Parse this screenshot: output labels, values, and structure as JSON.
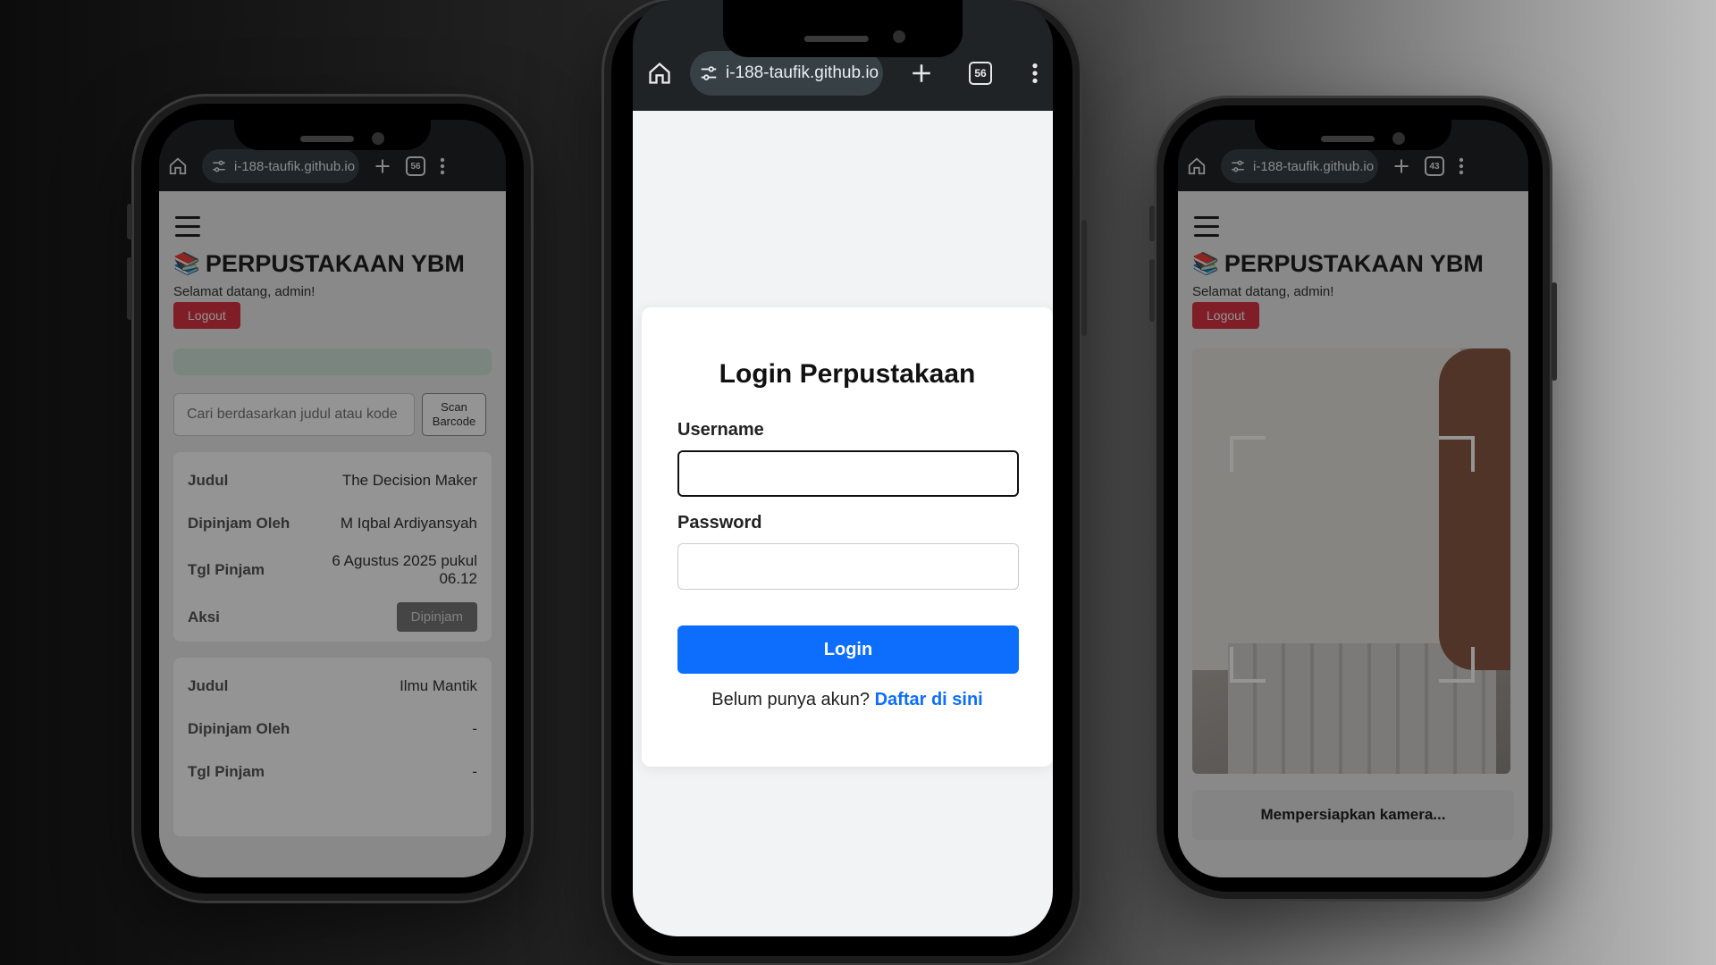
{
  "browser": {
    "url_left": "i-188-taufik.github.io",
    "url_center": "i-188-taufik.github.io",
    "url_right": "i-188-taufik.github.io",
    "tabs_left": "56",
    "tabs_center": "56",
    "tabs_right": "43",
    "icons": [
      "home-icon",
      "site-settings-icon",
      "new-tab-icon",
      "tab-switcher-icon",
      "menu-kebab-icon"
    ]
  },
  "app": {
    "title": "PERPUSTAKAAN YBM",
    "welcome": "Selamat datang, admin!",
    "logout_label": "Logout",
    "search_placeholder": "Cari berdasarkan judul atau kode",
    "scan_label": "Scan Barcode",
    "records": [
      {
        "k1": "Judul",
        "v1": "The Decision Maker",
        "k2": "Dipinjam Oleh",
        "v2": "M Iqbal Ardiyansyah",
        "k3": "Tgl Pinjam",
        "v3": "6 Agustus 2025 pukul 06.12",
        "k4": "Aksi",
        "action": "Dipinjam"
      },
      {
        "k1": "Judul",
        "v1": "Ilmu Mantik",
        "k2": "Dipinjam Oleh",
        "v2": "-",
        "k3": "Tgl Pinjam",
        "v3": "-"
      }
    ],
    "camera_status": "Mempersiapkan kamera..."
  },
  "login": {
    "title": "Login Perpustakaan",
    "username_label": "Username",
    "username_value": "",
    "password_label": "Password",
    "password_value": "",
    "button_label": "Login",
    "signup_prompt": "Belum punya akun?",
    "signup_link": "Daftar di sini"
  },
  "colors": {
    "primary": "#0d6efd",
    "danger": "#dc3545",
    "toolbar": "#1f2326"
  }
}
